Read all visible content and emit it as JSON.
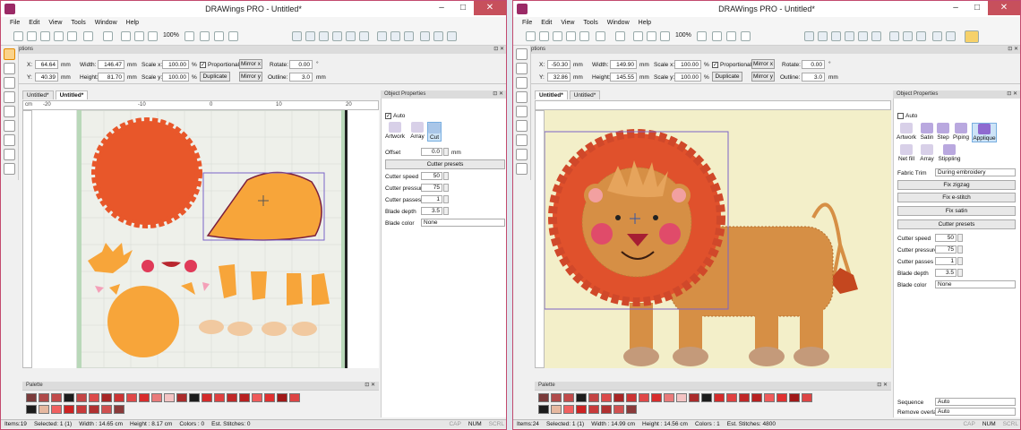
{
  "windows": [
    {
      "title": "DRAWings PRO - Untitled*",
      "menu": [
        "File",
        "Edit",
        "View",
        "Tools",
        "Window",
        "Help"
      ],
      "zoom": "100%",
      "tool_options": {
        "header": "Tool options",
        "x_label": "X:",
        "x_value": "64.64",
        "y_label": "Y:",
        "y_value": "40.39",
        "unit": "mm",
        "width_label": "Width:",
        "width_value": "146.47",
        "height_label": "Height:",
        "height_value": "81.70",
        "scalex_label": "Scale x:",
        "scalex_value": "100.00",
        "scaley_label": "Scale y:",
        "scaley_value": "100.00",
        "percent": "%",
        "proportional_label": "Proportional",
        "duplicate_label": "Duplicate",
        "mirrorx_label": "Mirror x",
        "mirrory_label": "Mirror y",
        "rotate_label": "Rotate:",
        "rotate_value": "0.00",
        "deg": "°",
        "outline_label": "Outline:",
        "outline_value": "3.0"
      },
      "tabs": [
        "Untitled*",
        "Untitled*"
      ],
      "ruler_unit": "cm",
      "ruler_ticks": [
        "-20",
        "-10",
        "0",
        "10",
        "20"
      ],
      "object_properties": {
        "header": "Object Properties",
        "auto_label": "Auto",
        "tools": [
          "Artwork",
          "Array",
          "Cut"
        ],
        "offset_label": "Offset",
        "offset_value": "0.0",
        "offset_unit": "mm",
        "cutter_presets": "Cutter presets",
        "fields": [
          {
            "label": "Cutter speed",
            "value": "50"
          },
          {
            "label": "Cutter pressure",
            "value": "75"
          },
          {
            "label": "Cutter passes",
            "value": "1"
          },
          {
            "label": "Blade depth",
            "value": "3.5"
          }
        ],
        "blade_color_label": "Blade color",
        "blade_color_value": "None"
      },
      "palette_header": "Palette",
      "status": [
        "Items:19",
        "Selected: 1 (1)",
        "Width : 14.65 cm",
        "Height : 8.17 cm",
        "Colors : 0",
        "Est. Stitches: 0"
      ],
      "status_right": [
        "CAP",
        "NUM",
        "SCRL"
      ]
    },
    {
      "title": "DRAWings PRO - Untitled*",
      "menu": [
        "File",
        "Edit",
        "View",
        "Tools",
        "Window",
        "Help"
      ],
      "zoom": "100%",
      "tool_options": {
        "header": "Tool options",
        "x_label": "X:",
        "x_value": "-50.30",
        "y_label": "Y:",
        "y_value": "32.86",
        "unit": "mm",
        "width_label": "Width:",
        "width_value": "149.90",
        "height_label": "Height:",
        "height_value": "145.55",
        "scalex_label": "Scale x:",
        "scalex_value": "100.00",
        "scaley_label": "Scale y:",
        "scaley_value": "100.00",
        "percent": "%",
        "proportional_label": "Proportional",
        "duplicate_label": "Duplicate",
        "mirrorx_label": "Mirror x",
        "mirrory_label": "Mirror y",
        "rotate_label": "Rotate:",
        "rotate_value": "0.00",
        "deg": "°",
        "outline_label": "Outline:",
        "outline_value": "3.0"
      },
      "tabs": [
        "Untitled*",
        "Untitled*"
      ],
      "object_properties": {
        "header": "Object Properties",
        "auto_label": "Auto",
        "tools": [
          "Artwork",
          "Satin",
          "Step",
          "Piping",
          "Applique",
          "Net fill",
          "Array",
          "Stippling"
        ],
        "fabric_trim_label": "Fabric Trim",
        "fabric_trim_value": "During embroidery",
        "buttons": [
          "Fix zigzag",
          "Fix e-stitch",
          "Fix satin",
          "Cutter presets"
        ],
        "fields": [
          {
            "label": "Cutter speed",
            "value": "50"
          },
          {
            "label": "Cutter pressure",
            "value": "75"
          },
          {
            "label": "Cutter passes",
            "value": "1"
          },
          {
            "label": "Blade depth",
            "value": "3.5"
          }
        ],
        "blade_color_label": "Blade color",
        "blade_color_value": "None",
        "sequence_label": "Sequence",
        "sequence_value": "Auto",
        "overlaps_label": "Remove overlaps",
        "overlaps_value": "Auto"
      },
      "palette_header": "Palette",
      "status": [
        "Items:24",
        "Selected: 1 (1)",
        "Width : 14.99 cm",
        "Height : 14.56 cm",
        "Colors : 1",
        "Est. Stitches: 4800"
      ],
      "status_right": [
        "CAP",
        "NUM",
        "SCRL"
      ]
    }
  ],
  "colors": {
    "accent_border": "#c34a6e",
    "mane": "#e8572a",
    "body": "#f7a53a",
    "lion_body": "#d68f45",
    "canvas_bg": "#f3efc9",
    "selection": "#7b63c8"
  },
  "palette_swatches": [
    "#7a3b3b",
    "#b04a4a",
    "#c24a4a",
    "#1c1c1c",
    "#c44444",
    "#dc4a4a",
    "#a82525",
    "#c33",
    "#e04848",
    "#d82c2c",
    "#ea7a7a",
    "#f4c4c4",
    "#aa2b2b",
    "#1c1c1c",
    "#d42a2a",
    "#e04040",
    "#c02828",
    "#b82020",
    "#f05a5a",
    "#e03030",
    "#a01818",
    "#d44",
    "#1c1c1c",
    "#e6b8a0",
    "#f06060",
    "#cc2222",
    "#c83a3a",
    "#b03030",
    "#d05050",
    "#8a3a3a"
  ]
}
